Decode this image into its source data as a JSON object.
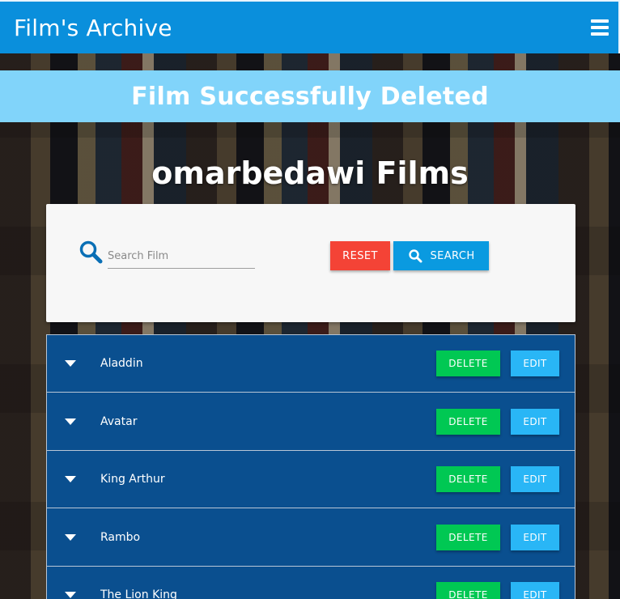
{
  "header": {
    "title": "Film's Archive",
    "menu_icon": "hamburger-menu-icon"
  },
  "alert": {
    "message": "Film Successfully Deleted",
    "color": "#81d4fa"
  },
  "page": {
    "heading": "omarbedawi Films"
  },
  "search": {
    "placeholder": "Search Film",
    "value": "",
    "reset_label": "RESET",
    "search_label": "SEARCH",
    "icon": "search-icon"
  },
  "films": [
    {
      "title": "Aladdin",
      "delete_label": "DELETE",
      "edit_label": "EDIT"
    },
    {
      "title": "Avatar",
      "delete_label": "DELETE",
      "edit_label": "EDIT"
    },
    {
      "title": "King Arthur",
      "delete_label": "DELETE",
      "edit_label": "EDIT"
    },
    {
      "title": "Rambo",
      "delete_label": "DELETE",
      "edit_label": "EDIT"
    },
    {
      "title": "The Lion King",
      "delete_label": "DELETE",
      "edit_label": "EDIT"
    }
  ],
  "colors": {
    "topbar": "#0a8fdc",
    "list_bg": "#0a4f8f",
    "reset": "#f44336",
    "search": "#0a9ae0",
    "delete": "#00c853",
    "edit": "#29b6f6"
  }
}
